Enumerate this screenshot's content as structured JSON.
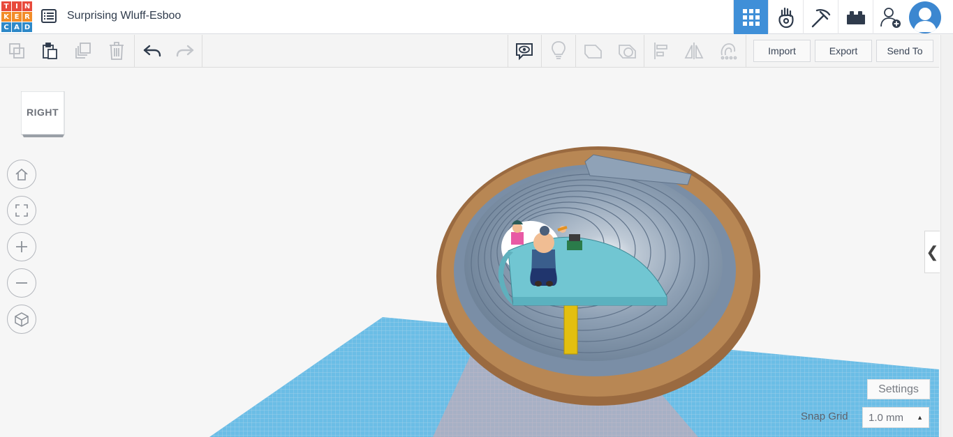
{
  "app": {
    "logo_letters": [
      "T",
      "I",
      "N",
      "K",
      "E",
      "R",
      "C",
      "A",
      "D"
    ],
    "logo_colors": [
      "#e84a3c",
      "#e84a3c",
      "#e84a3c",
      "#f28c28",
      "#f28c28",
      "#f28c28",
      "#2e89c8",
      "#2e89c8",
      "#2e89c8"
    ],
    "project_title": "Surprising Wluff-Esboo",
    "accent_color": "#3f8fd8"
  },
  "topbar": {
    "menu_icon": "list-icon",
    "view_buttons": [
      {
        "name": "3d-design-view",
        "icon": "grid-icon",
        "active": true
      },
      {
        "name": "blocks-view",
        "icon": "hand-icon",
        "active": false
      },
      {
        "name": "minecraft-view",
        "icon": "pickaxe-icon",
        "active": false
      },
      {
        "name": "bricks-view",
        "icon": "brick-icon",
        "active": false
      }
    ],
    "invite_icon": "add-user-icon",
    "avatar_icon": "user-avatar-icon"
  },
  "toolbar": {
    "left_tools": [
      {
        "name": "copy",
        "icon": "copy-icon"
      },
      {
        "name": "paste",
        "icon": "paste-icon"
      },
      {
        "name": "duplicate",
        "icon": "duplicate-icon"
      },
      {
        "name": "delete",
        "icon": "trash-icon"
      },
      {
        "name": "undo",
        "icon": "undo-icon"
      },
      {
        "name": "redo",
        "icon": "redo-icon"
      }
    ],
    "right_tools": [
      {
        "name": "notes",
        "icon": "eye-bubble-icon"
      },
      {
        "name": "light",
        "icon": "lightbulb-icon"
      },
      {
        "name": "solid",
        "icon": "solid-shape-icon"
      },
      {
        "name": "hole",
        "icon": "hole-shape-icon"
      },
      {
        "name": "align",
        "icon": "align-icon"
      },
      {
        "name": "mirror",
        "icon": "mirror-icon"
      },
      {
        "name": "group",
        "icon": "group-icon"
      }
    ],
    "import_label": "Import",
    "export_label": "Export",
    "send_to_label": "Send To"
  },
  "viewport": {
    "viewcube_label": "RIGHT",
    "nav_buttons": [
      {
        "name": "home-view",
        "icon": "home-icon"
      },
      {
        "name": "fit-view",
        "icon": "fit-icon"
      },
      {
        "name": "zoom-in",
        "icon": "plus-icon"
      },
      {
        "name": "zoom-out",
        "icon": "minus-icon"
      },
      {
        "name": "perspective",
        "icon": "cube-icon"
      }
    ],
    "panel_toggle": "❮",
    "settings_label": "Settings",
    "snap_grid_label": "Snap Grid",
    "snap_grid_value": "1.0 mm",
    "snap_arrow": "▲"
  }
}
